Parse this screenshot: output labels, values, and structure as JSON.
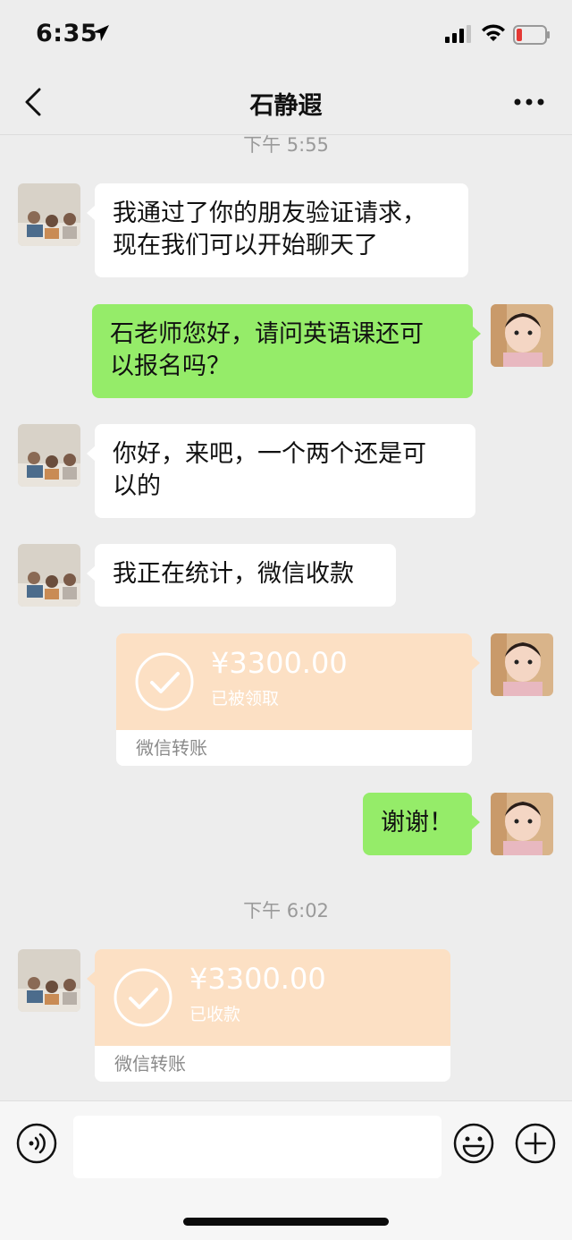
{
  "status_bar": {
    "time": "6:35"
  },
  "nav": {
    "title": "石静遐"
  },
  "messages": [
    {
      "type": "time",
      "text": "下午 5:55"
    },
    {
      "type": "text",
      "side": "left",
      "text_line1": "我通过了你的朋友验证请求，",
      "text_line2": "现在我们可以开始聊天了"
    },
    {
      "type": "text",
      "side": "right",
      "text_line1": "石老师您好，请问英语课还可",
      "text_line2": "以报名吗？"
    },
    {
      "type": "text",
      "side": "left",
      "text_line1": "你好，来吧，一个两个还是可",
      "text_line2": "以的"
    },
    {
      "type": "text",
      "side": "left",
      "text": "我正在统计，微信收款"
    },
    {
      "type": "transfer",
      "side": "right",
      "amount": "¥3300.00",
      "status": "已被领取",
      "label": "微信转账"
    },
    {
      "type": "text",
      "side": "right",
      "text": "谢谢！"
    },
    {
      "type": "time",
      "text": "下午 6:02"
    },
    {
      "type": "transfer",
      "side": "left",
      "amount": "¥3300.00",
      "status": "已收款",
      "label": "微信转账"
    }
  ],
  "colors": {
    "right_bubble": "#95ec69",
    "transfer_bg": "#fce0c4",
    "background": "#ededed"
  },
  "icons": [
    "location-arrow-icon",
    "signal-icon",
    "wifi-icon",
    "battery-icon",
    "back-icon",
    "more-icon",
    "check-icon",
    "voice-icon",
    "emoji-icon",
    "plus-icon"
  ]
}
